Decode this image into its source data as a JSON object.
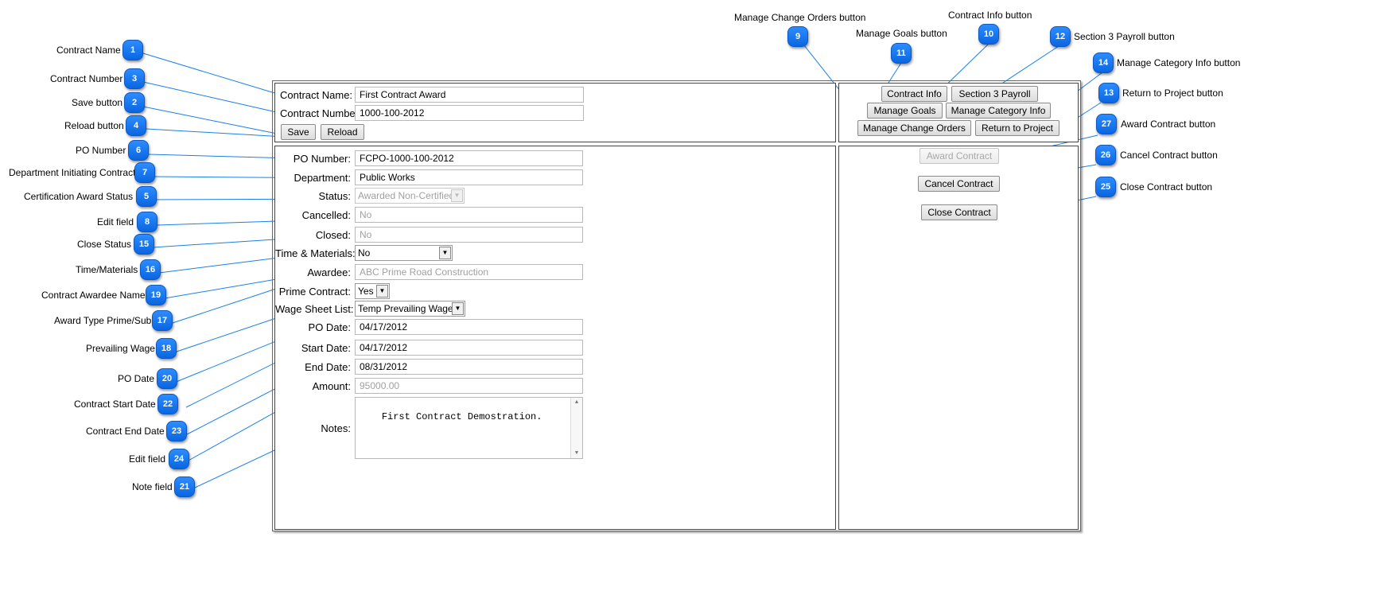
{
  "annotations": {
    "contract_name": {
      "label": "Contract Name",
      "num": "1"
    },
    "save_button": {
      "label": "Save button",
      "num": "2"
    },
    "contract_number": {
      "label": "Contract Number",
      "num": "3"
    },
    "reload_button": {
      "label": "Reload button",
      "num": "4"
    },
    "cert_status": {
      "label": "Certification  Award Status",
      "num": "5"
    },
    "po_number": {
      "label": "PO Number",
      "num": "6"
    },
    "department": {
      "label": "Department Initiating Contract",
      "num": "7"
    },
    "edit_field_8": {
      "label": "Edit field",
      "num": "8"
    },
    "change_orders": {
      "label": "Manage Change Orders button",
      "num": "9"
    },
    "contract_info": {
      "label": "Contract Info button",
      "num": "10"
    },
    "manage_goals": {
      "label": "Manage Goals button",
      "num": "11"
    },
    "section3": {
      "label": "Section 3 Payroll button",
      "num": "12"
    },
    "return_project": {
      "label": "Return to Project button",
      "num": "13"
    },
    "category_info": {
      "label": "Manage Category Info button",
      "num": "14"
    },
    "close_status": {
      "label": "Close Status",
      "num": "15"
    },
    "time_materials": {
      "label": "Time/Materials",
      "num": "16"
    },
    "award_type": {
      "label": "Award Type Prime/Sub",
      "num": "17"
    },
    "prevailing_wage": {
      "label": "Prevailing Wage",
      "num": "18"
    },
    "awardee_name": {
      "label": "Contract Awardee Name",
      "num": "19"
    },
    "po_date": {
      "label": "PO Date",
      "num": "20"
    },
    "note_field": {
      "label": "Note field",
      "num": "21"
    },
    "start_date": {
      "label": "Contract Start Date",
      "num": "22"
    },
    "end_date": {
      "label": "Contract End Date",
      "num": "23"
    },
    "edit_field_24": {
      "label": "Edit field",
      "num": "24"
    },
    "close_contract": {
      "label": "Close Contract button",
      "num": "25"
    },
    "cancel_contract": {
      "label": "Cancel Contract button",
      "num": "26"
    },
    "award_contract": {
      "label": "Award Contract button",
      "num": "27"
    }
  },
  "header": {
    "contract_name_label": "Contract Name:",
    "contract_name_value": "First Contract Award",
    "contract_number_label": "Contract Number:",
    "contract_number_value": "1000-100-2012",
    "save_label": "Save",
    "reload_label": "Reload"
  },
  "nav_buttons": {
    "contract_info": "Contract Info",
    "section3_payroll": "Section 3 Payroll",
    "manage_goals": "Manage Goals",
    "manage_category_info": "Manage Category Info",
    "manage_change_orders": "Manage Change Orders",
    "return_to_project": "Return to Project"
  },
  "form": {
    "po_number": {
      "label": "PO Number:",
      "value": "FCPO-1000-100-2012"
    },
    "department": {
      "label": "Department:",
      "value": "Public Works"
    },
    "status": {
      "label": "Status:",
      "value": "Awarded Non-Certified"
    },
    "cancelled": {
      "label": "Cancelled:",
      "value": "No"
    },
    "closed": {
      "label": "Closed:",
      "value": "No"
    },
    "time_materials": {
      "label": "Time & Materials:",
      "value": "No"
    },
    "awardee": {
      "label": "Awardee:",
      "value": "ABC Prime Road Construction"
    },
    "prime_contract": {
      "label": "Prime Contract:",
      "value": "Yes"
    },
    "wage_sheet": {
      "label": "Wage Sheet List:",
      "value": "Temp Prevailing Wage"
    },
    "po_date": {
      "label": "PO Date:",
      "value": "04/17/2012"
    },
    "start_date": {
      "label": "Start Date:",
      "value": "04/17/2012"
    },
    "end_date": {
      "label": "End Date:",
      "value": "08/31/2012"
    },
    "amount": {
      "label": "Amount:",
      "value": "95000.00"
    },
    "notes": {
      "label": "Notes:",
      "value": "First Contract Demostration."
    }
  },
  "actions": {
    "award_contract": "Award Contract",
    "cancel_contract": "Cancel Contract",
    "close_contract": "Close Contract"
  },
  "colors": {
    "badge": "#1877f2",
    "leader": "#1a7fe8"
  }
}
